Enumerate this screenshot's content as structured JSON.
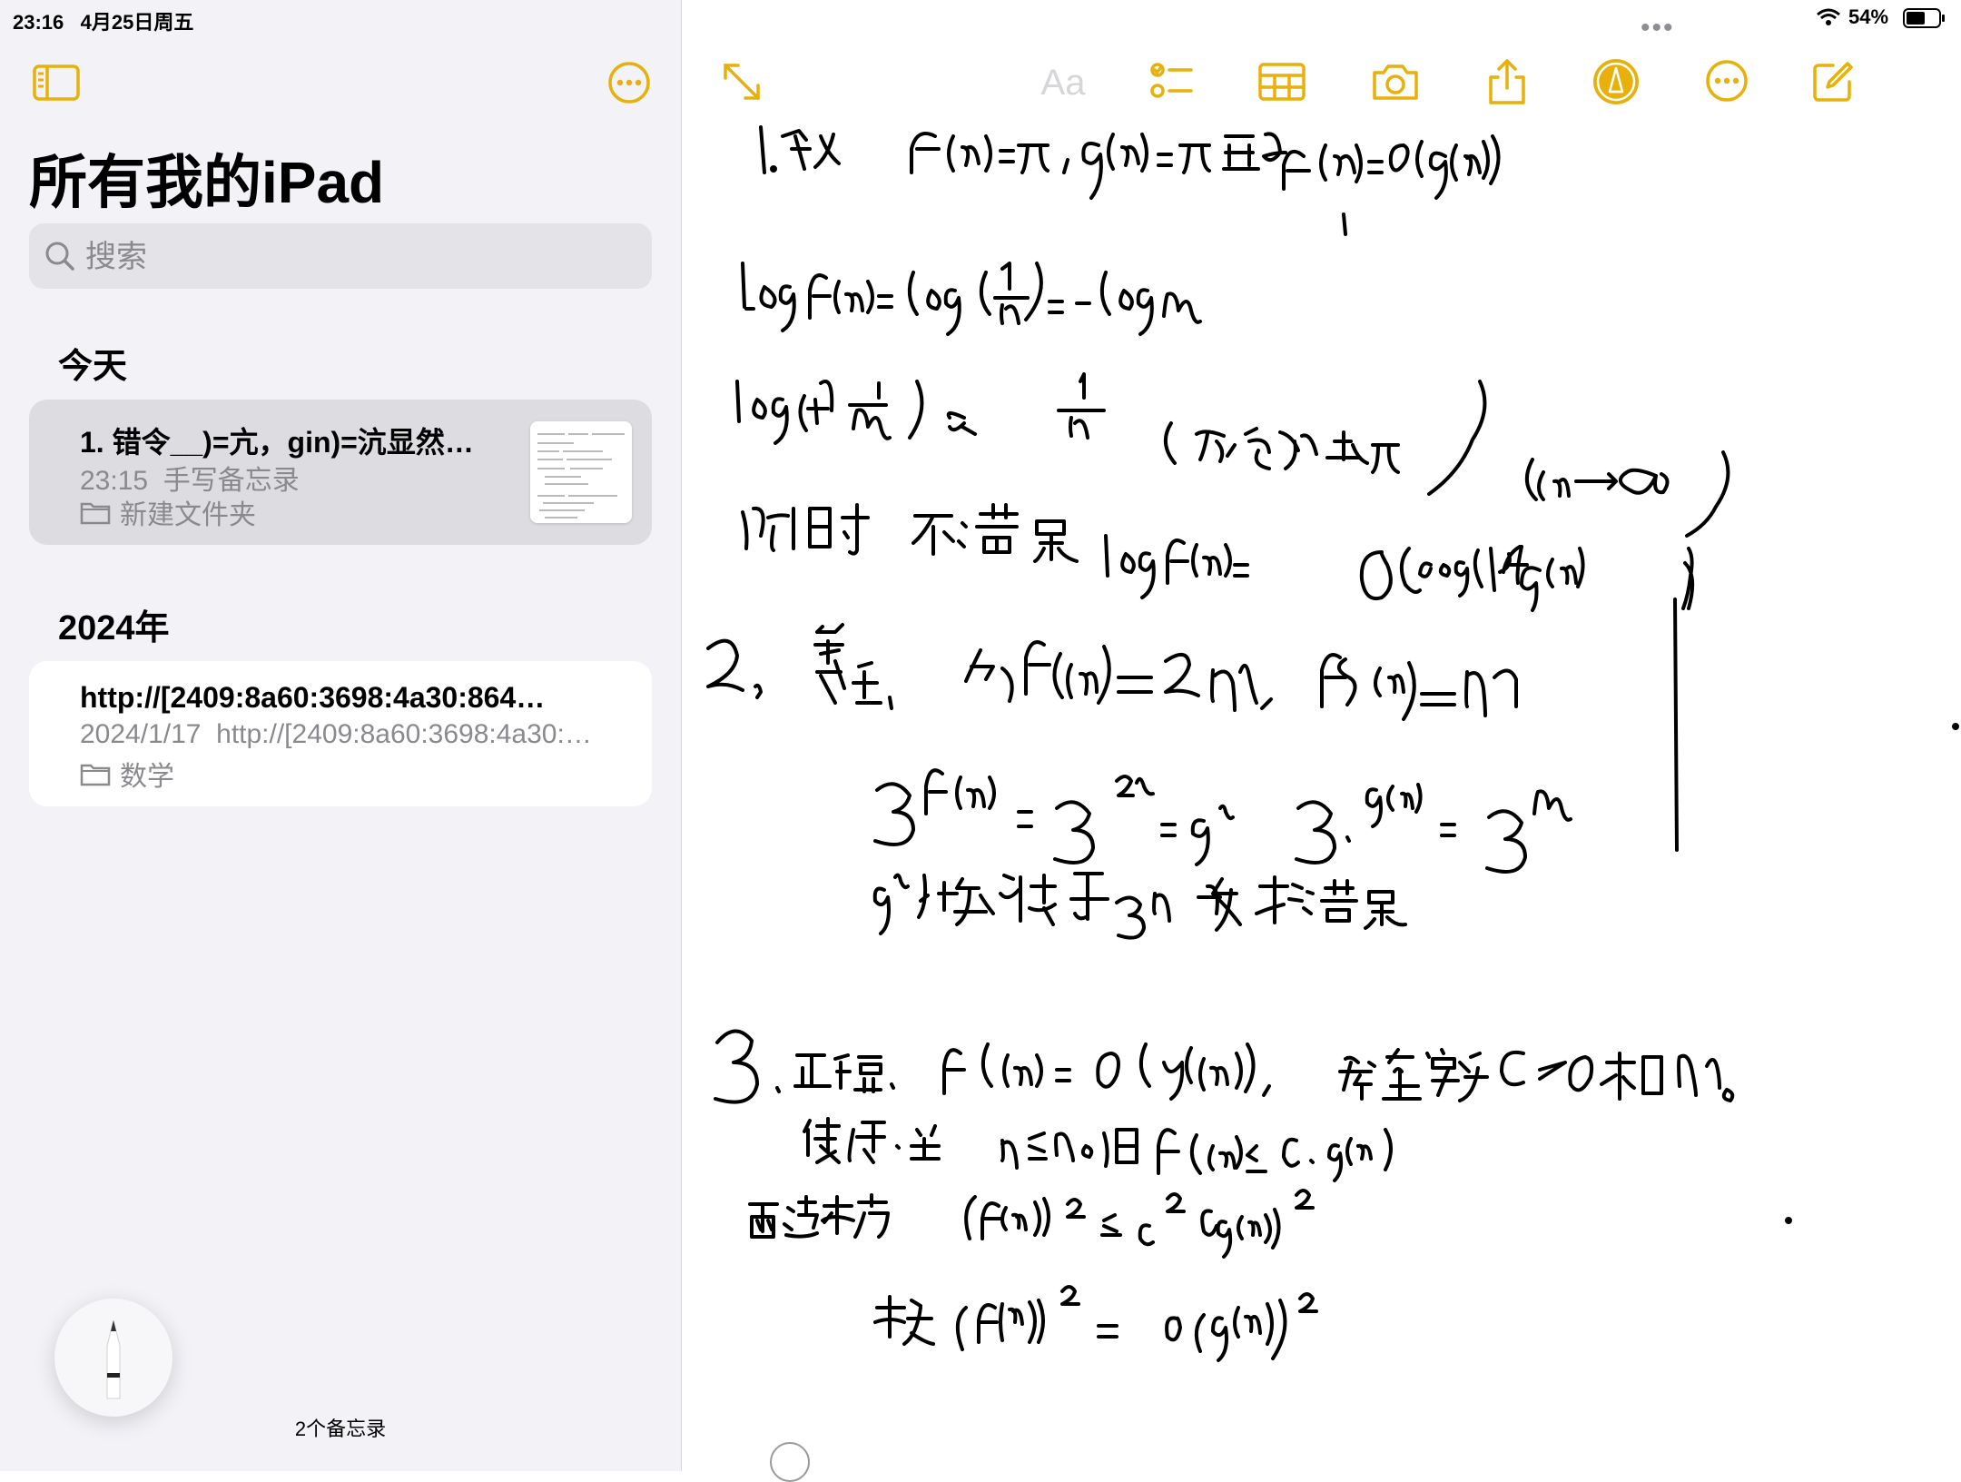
{
  "status": {
    "time": "23:16",
    "date": "4月25日周五",
    "battery": "54%"
  },
  "sidebar": {
    "title": "所有我的iPad",
    "search_placeholder": "搜索",
    "sections": [
      {
        "header": "今天",
        "notes": [
          {
            "title": "1. 错令__)=亢，gin)=沆显然…",
            "time": "23:15",
            "preview": "手写备忘录",
            "folder": "新建文件夹",
            "selected": true
          }
        ]
      },
      {
        "header": "2024年",
        "notes": [
          {
            "title": "http://[2409:8a60:3698:4a30:864…",
            "time": "2024/1/17",
            "preview": "http://[2409:8a60:3698:4a30:…",
            "folder": "数学",
            "selected": false
          }
        ]
      }
    ],
    "count": "2个备忘录"
  },
  "toolbar": {
    "format_label": "Aa",
    "accent": "#e8b00b",
    "icons": [
      "expand-icon",
      "checklist-icon",
      "table-icon",
      "camera-icon",
      "share-icon",
      "markup-icon",
      "more-icon",
      "compose-icon"
    ]
  },
  "handwriting": {
    "lines": [
      "1. 错 令 f(n)=1/n, g(n)=1/n 显然f(n)=O(g(n))",
      "log f(n) = log(1/n) = -log n",
      "log(1+1/n) ≈ 1/n (泰勒展开) (n→∞)",
      "此时 不满足 log f(n) = O(log(1+g(n)))",
      "2. 错, 令 f(n)=2n, g(n)=n",
      "3^f(n) = 3^2n = 9^n  3^g(n) = 3^n",
      "9^n 增长快于 3^n 故不满足",
      "3. 正确. f(n)=O(g(n)), 存在常数 c>0 和 n0",
      "使得 当 n≥n0 时 f(n) ≤ c·g(n)",
      "两边平方 (f(n))^2 ≤ c^2 (g(n))^2",
      "故 (f(n))^2 = O(g(n))^2"
    ]
  }
}
